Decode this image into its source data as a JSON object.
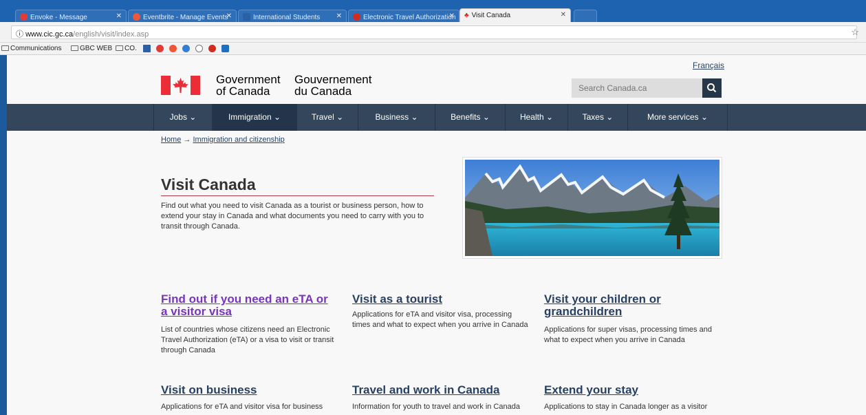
{
  "browser": {
    "tabs": [
      {
        "label": "Envoke - Message",
        "favicon_color": "#e53935"
      },
      {
        "label": "Eventbrite - Manage Events",
        "favicon_color": "#f05537"
      },
      {
        "label": "International Students",
        "favicon_color": "#2b5fa6"
      },
      {
        "label": "Electronic Travel Authorization",
        "favicon_color": "#d52b1e"
      },
      {
        "label": "Visit Canada",
        "favicon_color": "#d52b1e"
      }
    ],
    "url_host": "www.cic.gc.ca",
    "url_path": "/english/visit/index.asp",
    "bookmarks": [
      {
        "label": "Communications",
        "type": "folder"
      },
      {
        "label": "GBC WEB",
        "type": "folder"
      },
      {
        "label": "CO.",
        "type": "folder"
      }
    ]
  },
  "header": {
    "language_link": "Français",
    "gov_en_line1": "Government",
    "gov_en_line2": "of Canada",
    "gov_fr_line1": "Gouvernement",
    "gov_fr_line2": "du Canada",
    "search_placeholder": "Search Canada.ca",
    "brand_color": "#eb2d37"
  },
  "nav": {
    "items": [
      {
        "label": "Jobs ⌄"
      },
      {
        "label": "Immigration ⌄"
      },
      {
        "label": "Travel ⌄"
      },
      {
        "label": "Business ⌄"
      },
      {
        "label": "Benefits ⌄"
      },
      {
        "label": "Health ⌄"
      },
      {
        "label": "Taxes ⌄"
      },
      {
        "label": "More services ⌄"
      }
    ],
    "active_index": 1
  },
  "breadcrumb": {
    "home": "Home",
    "arrow": "→",
    "current": "Immigration and citizenship"
  },
  "main": {
    "title": "Visit Canada",
    "intro": "Find out what you need to visit Canada as a tourist or business person, how to extend your stay in Canada and what documents you need to carry with you to transit through Canada.",
    "cards": [
      {
        "title": "Find out if you need an eTA or a visitor visa",
        "desc": "List of countries whose citizens need an Electronic Travel Authorization (eTA) or a visa to visit or transit through Canada"
      },
      {
        "title": "Visit as a tourist",
        "desc": "Applications for eTA and visitor visa, processing times and what to expect when you arrive in Canada"
      },
      {
        "title": "Visit your children or grandchildren",
        "desc": "Applications for super visas, processing times and what to expect when you arrive in Canada"
      },
      {
        "title": "Visit on business",
        "desc": "Applications for eTA and visitor visa for business"
      },
      {
        "title": "Travel and work in Canada",
        "desc": "Information for youth to travel and work in Canada"
      },
      {
        "title": "Extend your stay",
        "desc": "Applications to stay in Canada longer as a visitor"
      }
    ]
  }
}
